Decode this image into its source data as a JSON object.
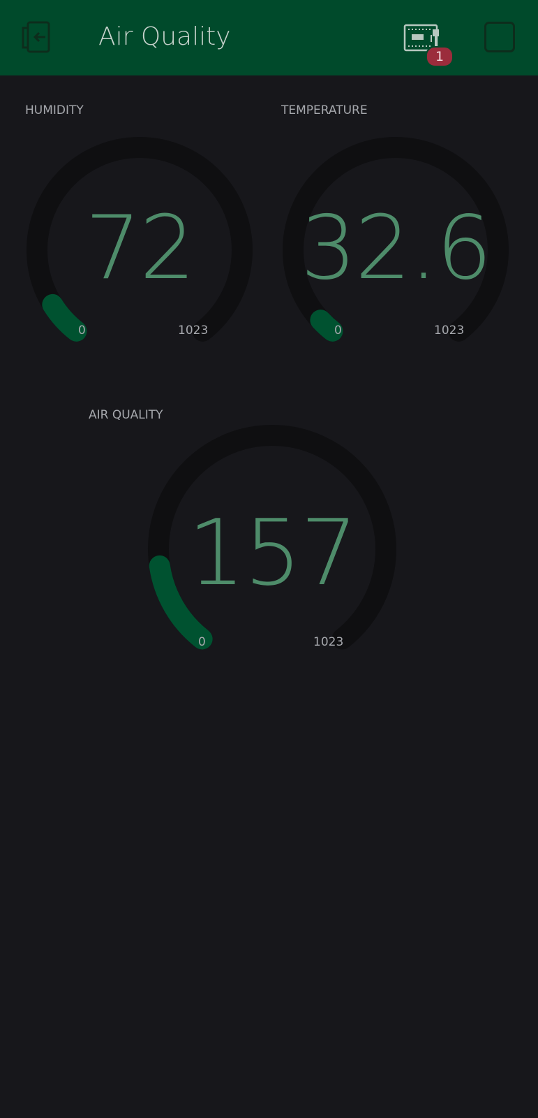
{
  "header": {
    "title": "Air Quality",
    "device_badge_count": "1",
    "background_color": "#004a2b"
  },
  "gauges": [
    {
      "label": "HUMIDITY",
      "value": "72",
      "min": "0",
      "max": "1023"
    },
    {
      "label": "TEMPERATURE",
      "value": "32.6",
      "min": "0",
      "max": "1023"
    },
    {
      "label": "AIR QUALITY",
      "value": "157",
      "min": "0",
      "max": "1023"
    }
  ],
  "colors": {
    "gauge_track": "#0f0f11",
    "gauge_fill": "#005230",
    "value_text": "#4e8c6a",
    "label_text": "#a6a8ad",
    "badge": "#9b2c3c"
  },
  "icons": {
    "back": "back-arrow-icon",
    "device": "device-board-icon",
    "stop": "stop-square-icon"
  }
}
